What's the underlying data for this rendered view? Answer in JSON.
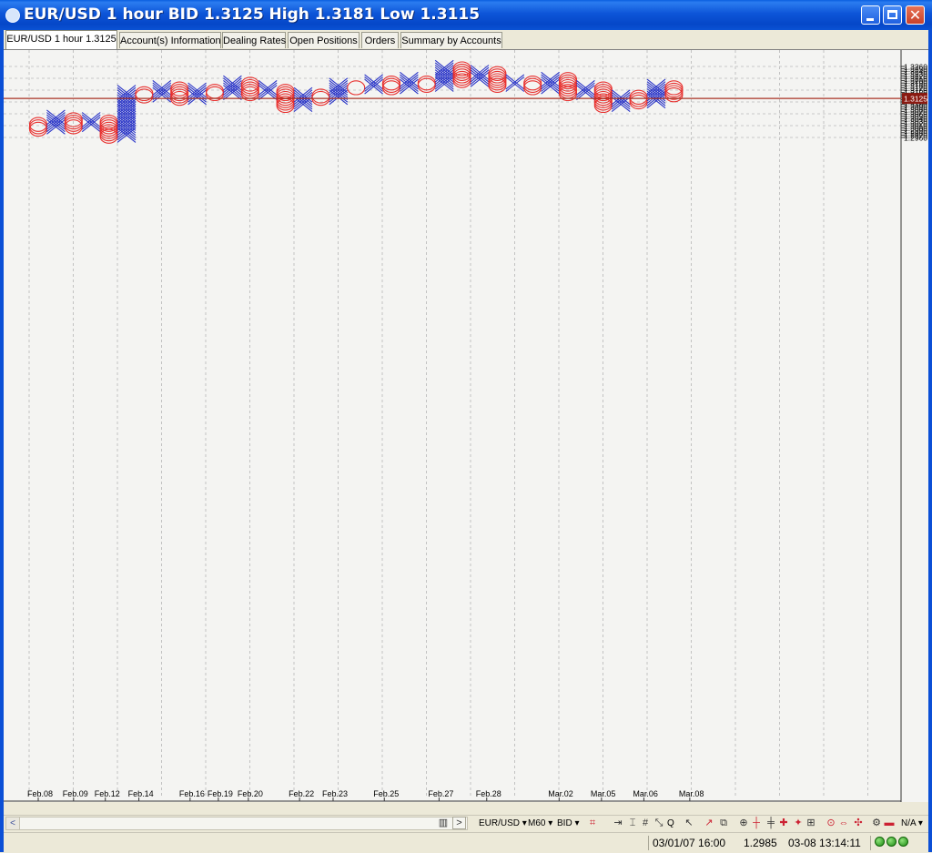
{
  "window": {
    "title": "EUR/USD 1 hour BID 1.3125  High 1.3181 Low 1.3115"
  },
  "tabs": [
    {
      "label": "EUR/USD 1 hour 1.3125",
      "active": true
    },
    {
      "label": "Account(s) Information",
      "active": false
    },
    {
      "label": "Dealing Rates",
      "active": false
    },
    {
      "label": "Open Positions",
      "active": false
    },
    {
      "label": "Orders",
      "active": false
    },
    {
      "label": "Summary by Accounts",
      "active": false
    }
  ],
  "toolbar": {
    "instrument": "EUR/USD",
    "period": "M60",
    "side": "BID",
    "zoom_label": "Q",
    "zoom_mode": "N/A"
  },
  "status": {
    "datetime": "03/01/07 16:00",
    "value": "1.2985",
    "clock": "03-08 13:14:11"
  },
  "colors": {
    "x_color": "#2a35c8",
    "o_color": "#e8302e",
    "current_line": "#a83224",
    "current_label_bg": "#8a1a12"
  },
  "chart_data": {
    "type": "point-and-figure",
    "instrument": "EUR/USD",
    "timeframe": "1 hour",
    "box_size": 0.001,
    "y_range": [
      1.2955,
      1.3265
    ],
    "y_ticks": [
      1.296,
      1.297,
      1.298,
      1.299,
      1.3,
      1.301,
      1.302,
      1.303,
      1.304,
      1.305,
      1.306,
      1.307,
      1.308,
      1.309,
      1.31,
      1.311,
      1.312,
      1.313,
      1.314,
      1.315,
      1.316,
      1.317,
      1.318,
      1.319,
      1.32,
      1.321,
      1.322,
      1.323,
      1.324,
      1.325,
      1.326
    ],
    "current_price": 1.3125,
    "current_price_label": "1.3125",
    "x_labels": [
      {
        "label": "Feb.08",
        "col": 0.0
      },
      {
        "label": "Feb.09",
        "col": 2.0
      },
      {
        "label": "Feb.12",
        "col": 3.8
      },
      {
        "label": "Feb.14",
        "col": 5.7
      },
      {
        "label": "Feb.16",
        "col": 8.6
      },
      {
        "label": "Feb.19",
        "col": 10.2
      },
      {
        "label": "Feb.20",
        "col": 11.9
      },
      {
        "label": "Feb.22",
        "col": 14.8
      },
      {
        "label": "Feb.23",
        "col": 16.7
      },
      {
        "label": "Feb.25",
        "col": 19.6
      },
      {
        "label": "Feb.27",
        "col": 22.7
      },
      {
        "label": "Feb.28",
        "col": 25.4
      },
      {
        "label": "Mar.02",
        "col": 29.5
      },
      {
        "label": "Mar.05",
        "col": 31.9
      },
      {
        "label": "Mar.06",
        "col": 34.3
      },
      {
        "label": "Mar.08",
        "col": 36.9
      }
    ],
    "columns": [
      {
        "type": "O",
        "top": 1.3015,
        "bottom": 1.2995
      },
      {
        "type": "X",
        "bottom": 1.3005,
        "top": 1.304
      },
      {
        "type": "O",
        "top": 1.3035,
        "bottom": 1.3005
      },
      {
        "type": "X",
        "bottom": 1.3015,
        "top": 1.3035
      },
      {
        "type": "O",
        "top": 1.303,
        "bottom": 1.2965
      },
      {
        "type": "X",
        "bottom": 1.297,
        "top": 1.315
      },
      {
        "type": "O",
        "top": 1.3145,
        "bottom": 1.3135
      },
      {
        "type": "X",
        "bottom": 1.314,
        "top": 1.317
      },
      {
        "type": "O",
        "top": 1.3165,
        "bottom": 1.3125
      },
      {
        "type": "X",
        "bottom": 1.313,
        "top": 1.316
      },
      {
        "type": "O",
        "top": 1.3155,
        "bottom": 1.3145
      },
      {
        "type": "X",
        "bottom": 1.315,
        "top": 1.319
      },
      {
        "type": "O",
        "top": 1.3185,
        "bottom": 1.3145
      },
      {
        "type": "X",
        "bottom": 1.315,
        "top": 1.317
      },
      {
        "type": "O",
        "top": 1.316,
        "bottom": 1.3095
      },
      {
        "type": "X",
        "bottom": 1.31,
        "top": 1.314
      },
      {
        "type": "O",
        "top": 1.3135,
        "bottom": 1.3125
      },
      {
        "type": "X",
        "bottom": 1.313,
        "top": 1.318
      },
      {
        "type": "O",
        "top": 1.3175,
        "bottom": 1.317
      },
      {
        "type": "X",
        "bottom": 1.3175,
        "top": 1.3195
      },
      {
        "type": "O",
        "top": 1.319,
        "bottom": 1.317
      },
      {
        "type": "X",
        "bottom": 1.3175,
        "top": 1.32
      },
      {
        "type": "O",
        "top": 1.3195,
        "bottom": 1.318
      },
      {
        "type": "X",
        "bottom": 1.3185,
        "top": 1.3255
      },
      {
        "type": "O",
        "top": 1.325,
        "bottom": 1.32
      },
      {
        "type": "X",
        "bottom": 1.3205,
        "top": 1.3235
      },
      {
        "type": "O",
        "top": 1.323,
        "bottom": 1.318
      },
      {
        "type": "X",
        "bottom": 1.3185,
        "top": 1.3195
      },
      {
        "type": "O",
        "top": 1.319,
        "bottom": 1.317
      },
      {
        "type": "X",
        "bottom": 1.3175,
        "top": 1.3205
      },
      {
        "type": "O",
        "top": 1.32,
        "bottom": 1.3145
      },
      {
        "type": "X",
        "bottom": 1.315,
        "top": 1.317
      },
      {
        "type": "O",
        "top": 1.3165,
        "bottom": 1.3095
      },
      {
        "type": "X",
        "bottom": 1.31,
        "top": 1.313
      },
      {
        "type": "O",
        "top": 1.3125,
        "bottom": 1.311
      },
      {
        "type": "X",
        "bottom": 1.3115,
        "top": 1.318
      },
      {
        "type": "O",
        "top": 1.3175,
        "bottom": 1.314
      }
    ]
  }
}
